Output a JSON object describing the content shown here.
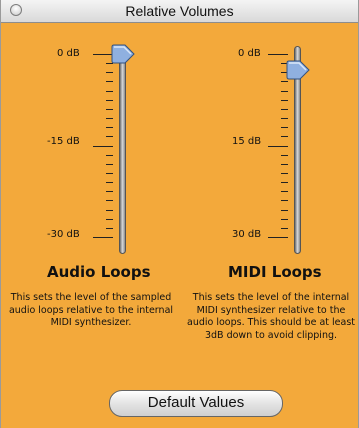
{
  "window": {
    "title": "Relative Volumes"
  },
  "audio": {
    "labels": {
      "top": "0 dB",
      "mid": "-15 dB",
      "bottom": "-30 dB"
    },
    "title": "Audio Loops",
    "description": "This sets the level of the sampled audio loops relative to the internal MIDI synthesizer.",
    "level": 1.0
  },
  "midi": {
    "labels": {
      "top": "0 dB",
      "mid": "15 dB",
      "bottom": "30 dB"
    },
    "title": "MIDI Loops",
    "description": "This sets the level of the internal MIDI synthesizer relative to the audio loops. This should be at least 3dB down to avoid clipping.",
    "level": 0.91
  },
  "buttons": {
    "default_values": "Default Values"
  },
  "colors": {
    "background": "#f3a93b",
    "thumb": "#8fb0e0"
  },
  "icons": [
    "close-icon",
    "slider-thumb-icon"
  ]
}
